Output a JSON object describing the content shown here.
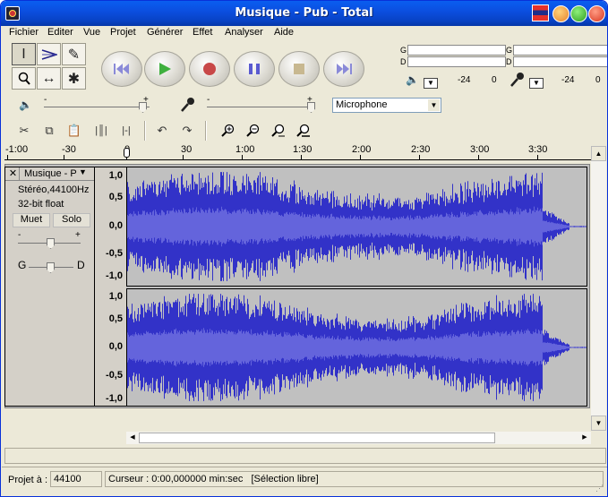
{
  "window": {
    "title": "Musique - Pub - Total"
  },
  "menu": [
    "Fichier",
    "Editer",
    "Vue",
    "Projet",
    "Générer",
    "Effet",
    "Analyser",
    "Aide"
  ],
  "meters": {
    "left_channel": "G",
    "right_channel": "D",
    "scale_a": "-24",
    "scale_b": "0"
  },
  "mixer": {
    "minus": "-",
    "plus": "+",
    "input_source": "Microphone"
  },
  "ruler": {
    "ticks": [
      "-1:00",
      "-30",
      "0",
      "30",
      "1:00",
      "1:30",
      "2:00",
      "2:30",
      "3:00",
      "3:30"
    ]
  },
  "track": {
    "close": "✕",
    "name": "Musique - P",
    "info_format": "Stéréo,44100Hz",
    "info_bits": "32-bit float",
    "mute_label": "Muet",
    "solo_label": "Solo",
    "gain_minus": "-",
    "gain_plus": "+",
    "pan_left": "G",
    "pan_right": "D"
  },
  "amplitude_labels": [
    "1,0",
    "0,5",
    "0,0",
    "-0,5",
    "-1,0"
  ],
  "status": {
    "project_rate_label": "Projet à :",
    "project_rate_value": "44100",
    "cursor_text": "Curseur : 0:00,000000 min:sec",
    "selection_text": "[Sélection libre]"
  },
  "colors": {
    "titlebar": "#0b4fe0",
    "waveform": "#3232c8",
    "waveform_rms": "#6464dc",
    "track_bg": "#c0c0c0"
  }
}
